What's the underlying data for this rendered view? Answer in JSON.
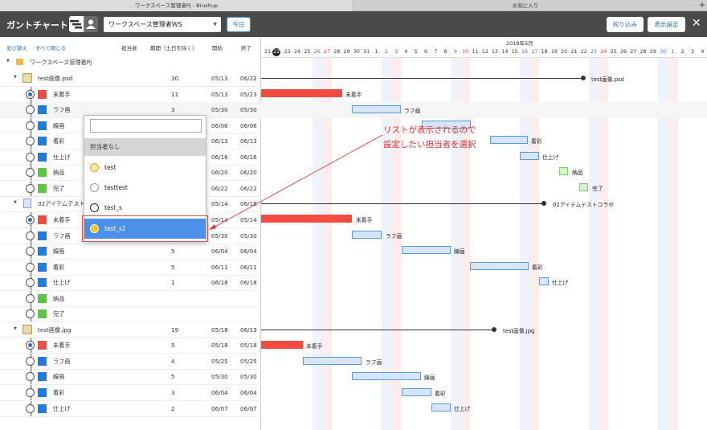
{
  "tabs": {
    "active": "ワークスペース管理者PJ - Brushup",
    "other": "お気に入り",
    "plus": "+"
  },
  "header": {
    "title": "ガントチャート",
    "workspace": "ワークスペース管理者WS",
    "today": "今日",
    "filter": "絞り込み",
    "display_settings": "表示設定",
    "close": "✕"
  },
  "columns": {
    "sort": "並び替え",
    "collapse": "すべて閉じる",
    "assignee": "担当者",
    "period": "期間（土日を除く）",
    "start": "開始",
    "end": "終了"
  },
  "month_label": "2018年6月",
  "days": [
    "21",
    "22",
    "23",
    "24",
    "25",
    "26",
    "27",
    "28",
    "29",
    "30",
    "31",
    "1",
    "2",
    "3",
    "4",
    "5",
    "6",
    "7",
    "8",
    "9",
    "10",
    "11",
    "12",
    "13",
    "14",
    "15",
    "16",
    "17",
    "18",
    "19",
    "20",
    "21",
    "22",
    "23",
    "24",
    "25",
    "26",
    "27",
    "28",
    "29",
    "30",
    "1",
    "2",
    "3",
    "4"
  ],
  "today_day": "22",
  "root_project": "ワークスペース管理者PJ",
  "rows": [
    {
      "type": "file",
      "name": "test画像.psd",
      "period": "30",
      "start": "05/13",
      "end": "06/22"
    },
    {
      "type": "task",
      "name": "未着手",
      "period": "11",
      "start": "05/13",
      "end": "05/23",
      "color": "#f24b3f",
      "radio": true
    },
    {
      "type": "task",
      "name": "ラフ画",
      "period": "3",
      "start": "05/30",
      "end": "05/30",
      "color": "#1e7be0"
    },
    {
      "type": "task",
      "name": "線画",
      "period": "",
      "start": "06/06",
      "end": "06/06",
      "color": "#1e7be0"
    },
    {
      "type": "task",
      "name": "着彩",
      "period": "",
      "start": "06/13",
      "end": "06/13",
      "color": "#1e7be0"
    },
    {
      "type": "task",
      "name": "仕上げ",
      "period": "",
      "start": "06/16",
      "end": "06/16",
      "color": "#1e7be0"
    },
    {
      "type": "task",
      "name": "納品",
      "period": "",
      "start": "06/20",
      "end": "06/20",
      "color": "#5ac83c"
    },
    {
      "type": "task",
      "name": "完了",
      "period": "",
      "start": "06/22",
      "end": "06/22",
      "color": "#5ac83c"
    },
    {
      "type": "file",
      "name": "02アイテムテスト",
      "period": "",
      "start": "05/14",
      "end": "06/18"
    },
    {
      "type": "task",
      "name": "未着手",
      "period": "",
      "start": "05/14",
      "end": "05/14",
      "color": "#f24b3f",
      "radio": true
    },
    {
      "type": "task",
      "name": "ラフ画",
      "period": "",
      "start": "05/30",
      "end": "05/30",
      "color": "#1e7be0"
    },
    {
      "type": "task",
      "name": "線画",
      "period": "5",
      "start": "06/04",
      "end": "06/04",
      "color": "#1e7be0"
    },
    {
      "type": "task",
      "name": "着彩",
      "period": "5",
      "start": "06/11",
      "end": "06/11",
      "color": "#1e7be0"
    },
    {
      "type": "task",
      "name": "仕上げ",
      "period": "1",
      "start": "06/18",
      "end": "06/18",
      "color": "#1e7be0"
    },
    {
      "type": "task",
      "name": "納品",
      "period": "",
      "start": "",
      "end": "",
      "color": "#5ac83c"
    },
    {
      "type": "task",
      "name": "完了",
      "period": "",
      "start": "",
      "end": "",
      "color": "#5ac83c"
    },
    {
      "type": "file",
      "name": "test画像.jpg",
      "period": "19",
      "start": "05/18",
      "end": "06/13"
    },
    {
      "type": "task",
      "name": "未着手",
      "period": "5",
      "start": "05/18",
      "end": "05/18",
      "color": "#f24b3f",
      "radio": true
    },
    {
      "type": "task",
      "name": "ラフ画",
      "period": "4",
      "start": "05/25",
      "end": "05/25",
      "color": "#1e7be0"
    },
    {
      "type": "task",
      "name": "線画",
      "period": "5",
      "start": "05/30",
      "end": "05/30",
      "color": "#1e7be0"
    },
    {
      "type": "task",
      "name": "着彩",
      "period": "3",
      "start": "06/04",
      "end": "06/04",
      "color": "#1e7be0"
    },
    {
      "type": "task",
      "name": "仕上げ",
      "period": "2",
      "start": "06/07",
      "end": "06/07",
      "color": "#1e7be0"
    }
  ],
  "bar_labels": {
    "psd": "test画像.psd",
    "unstarted": "未着手",
    "rough": "ラフ画",
    "lineart": "線画",
    "coloring": "着彩",
    "finish": "仕上げ",
    "delivery": "納品",
    "complete": "完了",
    "item02": "02アイテムテストコラボ",
    "jpg": "test画像.jpg"
  },
  "dropdown": {
    "none": "担当者なし",
    "users": [
      "test",
      "testtest",
      "test_s",
      "test_s2"
    ],
    "selected": "test_s2"
  },
  "callout": {
    "line1": "リストが表示されるので",
    "line2": "設定したい担当者を選択"
  }
}
